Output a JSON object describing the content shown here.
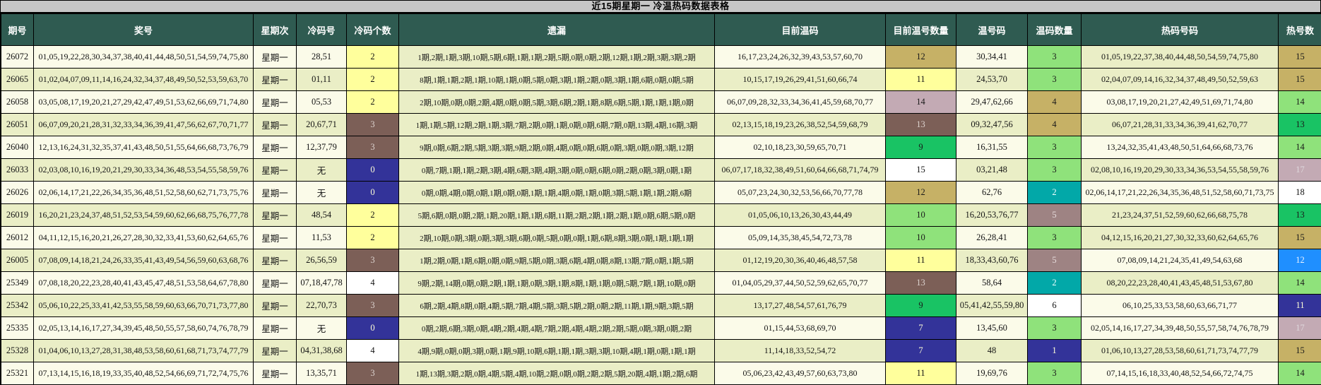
{
  "title": "近15期星期一 冷温热码数据表格",
  "columns": [
    {
      "key": "period",
      "label": "期号"
    },
    {
      "key": "winning",
      "label": "奖号"
    },
    {
      "key": "weekday",
      "label": "星期次"
    },
    {
      "key": "cold_nums",
      "label": "冷码号"
    },
    {
      "key": "cold_count",
      "label": "冷码个数"
    },
    {
      "key": "omission",
      "label": "遗漏"
    },
    {
      "key": "warm_current",
      "label": "目前温码"
    },
    {
      "key": "warm_current_count",
      "label": "目前温号数量"
    },
    {
      "key": "warm_nums",
      "label": "温号码"
    },
    {
      "key": "warm_count",
      "label": "温码数量"
    },
    {
      "key": "hot_nums",
      "label": "热码号码"
    },
    {
      "key": "hot_count",
      "label": "热号数"
    }
  ],
  "palette": {
    "title_bg": "#C6C6C6",
    "header_bg": "#2F5B51",
    "header_fg": "#FFFFFF",
    "row_cream": "#FBFBE9",
    "row_green": "#EAEEC6",
    "omission_bg": "#EAEEC6",
    "yellow": {
      "bg": "#FFFF9C",
      "fg": "#141414"
    },
    "white": {
      "bg": "#FFFFFF",
      "fg": "#141414"
    },
    "navy": {
      "bg": "#333399",
      "fg": "#FFFFD7"
    },
    "brown": {
      "bg": "#7C5F57",
      "fg": "#DCD2CE"
    },
    "mauve": {
      "bg": "#9E8383",
      "fg": "#E8DEDE"
    },
    "pinkgray": {
      "bg": "#C3AAB4",
      "fg": "#1A1A1A"
    },
    "pinkgray_light": {
      "bg": "#C3AAB4",
      "fg": "#DFD8DC"
    },
    "khaki": {
      "bg": "#C6B166",
      "fg": "#1A1A1A"
    },
    "green": {
      "bg": "#19C364",
      "fg": "#1A1A1A"
    },
    "lightgreen": {
      "bg": "#8FE27B",
      "fg": "#1A1A1A"
    },
    "teal": {
      "bg": "#02A8A8",
      "fg": "#F2FFFF"
    },
    "blue": {
      "bg": "#1F8FFF",
      "fg": "#EAF2FF"
    }
  },
  "rows": [
    {
      "period": "26072",
      "winning": "01,05,19,22,28,30,34,37,38,40,41,44,48,50,51,54,59,74,75,80",
      "weekday": "星期一",
      "cold_nums": "28,51",
      "cold_count": {
        "v": "2",
        "c": "yellow"
      },
      "omission": "1期,2期,1期,3期,10期,5期,6期,1期,1期,2期,5期,0期,0期,2期,12期,1期,2期,3期,3期,2期",
      "warm_current": "16,17,23,24,26,32,39,43,53,57,60,70",
      "warm_current_count": {
        "v": "12",
        "c": "khaki"
      },
      "warm_nums": "30,34,41",
      "warm_count": {
        "v": "3",
        "c": "lightgreen"
      },
      "hot_nums": "01,05,19,22,37,38,40,44,48,50,54,59,74,75,80",
      "hot_shade": "green",
      "hot_count": {
        "v": "15",
        "c": "khaki"
      }
    },
    {
      "period": "26065",
      "winning": "01,02,04,07,09,11,14,16,24,32,34,37,48,49,50,52,53,59,63,70",
      "weekday": "星期一",
      "cold_nums": "01,11",
      "cold_count": {
        "v": "2",
        "c": "yellow"
      },
      "omission": "8期,1期,1期,2期,1期,10期,1期,0期,5期,0期,3期,1期,2期,0期,3期,1期,6期,0期,0期,5期",
      "warm_current": "10,15,17,19,26,29,41,51,60,66,74",
      "warm_current_count": {
        "v": "11",
        "c": "yellow"
      },
      "warm_nums": "24,53,70",
      "warm_count": {
        "v": "3",
        "c": "lightgreen"
      },
      "hot_nums": "02,04,07,09,14,16,32,34,37,48,49,50,52,59,63",
      "hot_shade": "green",
      "hot_count": {
        "v": "15",
        "c": "khaki"
      }
    },
    {
      "period": "26058",
      "winning": "03,05,08,17,19,20,21,27,29,42,47,49,51,53,62,66,69,71,74,80",
      "weekday": "星期一",
      "cold_nums": "05,53",
      "cold_count": {
        "v": "2",
        "c": "yellow"
      },
      "omission": "2期,10期,0期,0期,2期,4期,0期,0期,5期,3期,6期,2期,1期,8期,6期,5期,1期,1期,1期,0期",
      "warm_current": "06,07,09,28,32,33,34,36,41,45,59,68,70,77",
      "warm_current_count": {
        "v": "14",
        "c": "pinkgray"
      },
      "warm_nums": "29,47,62,66",
      "warm_count": {
        "v": "4",
        "c": "khaki"
      },
      "hot_nums": "03,08,17,19,20,21,27,42,49,51,69,71,74,80",
      "hot_shade": "cream",
      "hot_count": {
        "v": "14",
        "c": "lightgreen"
      }
    },
    {
      "period": "26051",
      "winning": "06,07,09,20,21,28,31,32,33,34,36,39,41,47,56,62,67,70,71,77",
      "weekday": "星期一",
      "cold_nums": "20,67,71",
      "cold_count": {
        "v": "3",
        "c": "brown"
      },
      "omission": "1期,1期,5期,12期,2期,1期,3期,7期,2期,0期,1期,0期,0期,6期,7期,0期,13期,4期,16期,3期",
      "warm_current": "02,13,15,18,19,23,26,38,52,54,59,68,79",
      "warm_current_count": {
        "v": "13",
        "c": "brown"
      },
      "warm_nums": "09,32,47,56",
      "warm_count": {
        "v": "4",
        "c": "khaki"
      },
      "hot_nums": "06,07,21,28,31,33,34,36,39,41,62,70,77",
      "hot_shade": "green",
      "hot_count": {
        "v": "13",
        "c": "green"
      }
    },
    {
      "period": "26040",
      "winning": "12,13,16,24,31,32,35,37,41,43,48,50,51,55,64,66,68,73,76,79",
      "weekday": "星期一",
      "cold_nums": "12,37,79",
      "cold_count": {
        "v": "3",
        "c": "brown"
      },
      "omission": "9期,0期,6期,2期,5期,3期,3期,9期,2期,0期,4期,0期,0期,6期,0期,3期,0期,0期,3期,12期",
      "warm_current": "02,10,18,23,30,59,65,70,71",
      "warm_current_count": {
        "v": "9",
        "c": "green"
      },
      "warm_nums": "16,31,55",
      "warm_count": {
        "v": "3",
        "c": "lightgreen"
      },
      "hot_nums": "13,24,32,35,41,43,48,50,51,64,66,68,73,76",
      "hot_shade": "cream",
      "hot_count": {
        "v": "14",
        "c": "lightgreen"
      }
    },
    {
      "period": "26033",
      "winning": "02,03,08,10,16,19,20,21,29,30,33,34,36,48,53,54,55,58,59,76",
      "weekday": "星期一",
      "cold_nums": "无",
      "cold_count": {
        "v": "0",
        "c": "navy"
      },
      "omission": "0期,7期,1期,1期,2期,3期,4期,6期,3期,4期,3期,0期,0期,6期,0期,2期,0期,3期,0期,1期",
      "warm_current": "06,07,17,18,32,38,49,51,60,64,66,68,71,74,79",
      "warm_current_count": {
        "v": "15",
        "c": "white"
      },
      "warm_nums": "03,21,48",
      "warm_count": {
        "v": "3",
        "c": "lightgreen"
      },
      "hot_nums": "02,08,10,16,19,20,29,30,33,34,36,53,54,55,58,59,76",
      "hot_shade": "green",
      "hot_count": {
        "v": "17",
        "c": "pinkgray_light"
      }
    },
    {
      "period": "26026",
      "winning": "02,06,14,17,21,22,26,34,35,36,48,51,52,58,60,62,71,73,75,76",
      "weekday": "星期一",
      "cold_nums": "无",
      "cold_count": {
        "v": "0",
        "c": "navy"
      },
      "omission": "0期,0期,4期,0期,0期,1期,0期,0期,1期,1期,4期,0期,1期,0期,3期,5期,1期,1期,2期,6期",
      "warm_current": "05,07,23,24,30,32,53,56,66,70,77,78",
      "warm_current_count": {
        "v": "12",
        "c": "khaki"
      },
      "warm_nums": "62,76",
      "warm_count": {
        "v": "2",
        "c": "teal"
      },
      "hot_nums": "02,06,14,17,21,22,26,34,35,36,48,51,52,58,60,71,73,75",
      "hot_shade": "cream",
      "hot_count": {
        "v": "18",
        "c": "white"
      }
    },
    {
      "period": "26019",
      "winning": "16,20,21,23,24,37,48,51,52,53,54,59,60,62,66,68,75,76,77,78",
      "weekday": "星期一",
      "cold_nums": "48,54",
      "cold_count": {
        "v": "2",
        "c": "yellow"
      },
      "omission": "5期,6期,0期,0期,2期,1期,20期,1期,1期,6期,11期,2期,2期,1期,2期,1期,0期,6期,5期,0期",
      "warm_current": "01,05,06,10,13,26,30,43,44,49",
      "warm_current_count": {
        "v": "10",
        "c": "lightgreen"
      },
      "warm_nums": "16,20,53,76,77",
      "warm_count": {
        "v": "5",
        "c": "mauve"
      },
      "hot_nums": "21,23,24,37,51,52,59,60,62,66,68,75,78",
      "hot_shade": "green",
      "hot_count": {
        "v": "13",
        "c": "green"
      }
    },
    {
      "period": "26012",
      "winning": "04,11,12,15,16,20,21,26,27,28,30,32,33,41,53,60,62,64,65,76",
      "weekday": "星期一",
      "cold_nums": "11,53",
      "cold_count": {
        "v": "2",
        "c": "yellow"
      },
      "omission": "2期,10期,0期,3期,0期,3期,3期,6期,0期,5期,0期,0期,1期,6期,8期,3期,0期,1期,1期,1期",
      "warm_current": "05,09,14,35,38,45,54,72,73,78",
      "warm_current_count": {
        "v": "10",
        "c": "lightgreen"
      },
      "warm_nums": "26,28,41",
      "warm_count": {
        "v": "3",
        "c": "lightgreen"
      },
      "hot_nums": "04,12,15,16,20,21,27,30,32,33,60,62,64,65,76",
      "hot_shade": "green",
      "hot_count": {
        "v": "15",
        "c": "khaki"
      }
    },
    {
      "period": "26005",
      "winning": "07,08,09,14,18,21,24,26,33,35,41,43,49,54,56,59,60,63,68,76",
      "weekday": "星期一",
      "cold_nums": "26,56,59",
      "cold_count": {
        "v": "3",
        "c": "brown"
      },
      "omission": "1期,2期,0期,1期,6期,0期,0期,9期,5期,0期,3期,6期,4期,0期,8期,13期,7期,0期,1期,5期",
      "warm_current": "01,12,19,20,30,36,40,46,48,57,58",
      "warm_current_count": {
        "v": "11",
        "c": "yellow"
      },
      "warm_nums": "18,33,43,60,76",
      "warm_count": {
        "v": "5",
        "c": "mauve"
      },
      "hot_nums": "07,08,09,14,21,24,35,41,49,54,63,68",
      "hot_shade": "cream",
      "hot_count": {
        "v": "12",
        "c": "blue"
      }
    },
    {
      "period": "25349",
      "winning": "07,08,18,20,22,23,28,40,41,43,45,47,48,51,53,58,64,67,78,80",
      "weekday": "星期一",
      "cold_nums": "07,18,47,78",
      "cold_count": {
        "v": "4",
        "c": "white"
      },
      "omission": "9期,2期,14期,0期,0期,2期,1期,1期,0期,3期,1期,8期,1期,1期,0期,5期,7期,1期,10期,0期",
      "warm_current": "01,04,05,29,37,44,50,52,59,62,65,70,77",
      "warm_current_count": {
        "v": "13",
        "c": "brown"
      },
      "warm_nums": "58,64",
      "warm_count": {
        "v": "2",
        "c": "teal"
      },
      "hot_nums": "08,20,22,23,28,40,41,43,45,48,51,53,67,80",
      "hot_shade": "green",
      "hot_count": {
        "v": "14",
        "c": "lightgreen"
      }
    },
    {
      "period": "25342",
      "winning": "05,06,10,22,25,33,41,42,53,55,58,59,60,63,66,70,71,73,77,80",
      "weekday": "星期一",
      "cold_nums": "22,70,73",
      "cold_count": {
        "v": "3",
        "c": "brown"
      },
      "omission": "6期,2期,4期,8期,0期,4期,5期,7期,4期,5期,3期,5期,2期,0期,2期,11期,1期,9期,3期,5期",
      "warm_current": "13,17,27,48,54,57,61,76,79",
      "warm_current_count": {
        "v": "9",
        "c": "green"
      },
      "warm_nums": "05,41,42,55,59,80",
      "warm_count": {
        "v": "6",
        "c": "white"
      },
      "hot_nums": "06,10,25,33,53,58,60,63,66,71,77",
      "hot_shade": "cream",
      "hot_count": {
        "v": "11",
        "c": "navy"
      }
    },
    {
      "period": "25335",
      "winning": "02,05,13,14,16,17,27,34,39,45,48,50,55,57,58,60,74,76,78,79",
      "weekday": "星期一",
      "cold_nums": "无",
      "cold_count": {
        "v": "0",
        "c": "navy"
      },
      "omission": "0期,2期,6期,3期,0期,4期,2期,4期,4期,7期,2期,4期,4期,2期,2期,5期,0期,3期,0期,2期",
      "warm_current": "01,15,44,53,68,69,70",
      "warm_current_count": {
        "v": "7",
        "c": "navy"
      },
      "warm_nums": "13,45,60",
      "warm_count": {
        "v": "3",
        "c": "lightgreen"
      },
      "hot_nums": "02,05,14,16,17,27,34,39,48,50,55,57,58,74,76,78,79",
      "hot_shade": "cream",
      "hot_count": {
        "v": "17",
        "c": "pinkgray_light"
      }
    },
    {
      "period": "25328",
      "winning": "01,04,06,10,13,27,28,31,38,48,53,58,60,61,68,71,73,74,77,79",
      "weekday": "星期一",
      "cold_nums": "04,31,38,68",
      "cold_count": {
        "v": "4",
        "c": "white"
      },
      "omission": "4期,9期,0期,0期,3期,0期,1期,9期,10期,6期,1期,1期,3期,3期,10期,4期,1期,0期,1期,1期",
      "warm_current": "11,14,18,33,52,54,72",
      "warm_current_count": {
        "v": "7",
        "c": "navy"
      },
      "warm_nums": "48",
      "warm_count": {
        "v": "1",
        "c": "navy"
      },
      "hot_nums": "01,06,10,13,27,28,53,58,60,61,71,73,74,77,79",
      "hot_shade": "green",
      "hot_count": {
        "v": "15",
        "c": "khaki"
      }
    },
    {
      "period": "25321",
      "winning": "07,13,14,15,16,18,19,33,35,40,48,52,54,66,69,71,72,74,75,76",
      "weekday": "星期一",
      "cold_nums": "13,35,71",
      "cold_count": {
        "v": "3",
        "c": "brown"
      },
      "omission": "1期,13期,3期,2期,0期,4期,5期,4期,10期,2期,0期,0期,2期,2期,5期,20期,4期,1期,2期,6期",
      "warm_current": "05,06,23,42,43,49,57,60,63,73,80",
      "warm_current_count": {
        "v": "11",
        "c": "yellow"
      },
      "warm_nums": "19,69,76",
      "warm_count": {
        "v": "3",
        "c": "lightgreen"
      },
      "hot_nums": "07,14,15,16,18,33,40,48,52,54,66,72,74,75",
      "hot_shade": "cream",
      "hot_count": {
        "v": "14",
        "c": "lightgreen"
      }
    }
  ]
}
